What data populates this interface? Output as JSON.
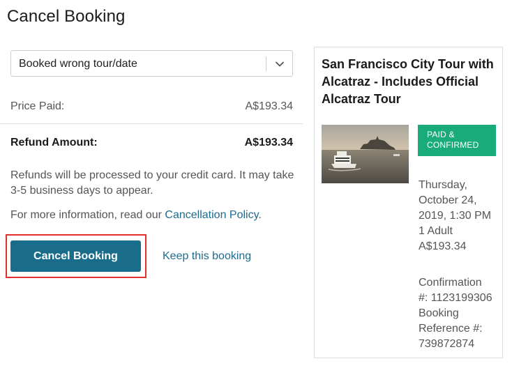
{
  "page": {
    "title": "Cancel Booking"
  },
  "reason_select": {
    "selected": "Booked wrong tour/date"
  },
  "pricing": {
    "price_paid_label": "Price Paid:",
    "price_paid_value": "A$193.34",
    "refund_label": "Refund Amount:",
    "refund_value": "A$193.34"
  },
  "notes": {
    "refund_note": "Refunds will be processed to your credit card. It may take 3-5 business days to appear.",
    "more_info_prefix": "For more information, read our ",
    "policy_link": "Cancellation Policy",
    "more_info_suffix": "."
  },
  "actions": {
    "cancel_label": "Cancel Booking",
    "keep_label": "Keep this booking"
  },
  "booking_card": {
    "title": "San Francisco City Tour with Alcatraz - Includes Official Alcatraz Tour",
    "status_line1": "PAID &",
    "status_line2": "CONFIRMED",
    "date_line1": "Thursday,",
    "date_line2": "October 24,",
    "date_line3": "2019, 1:30 PM",
    "travelers": "1 Adult",
    "price": "A$193.34",
    "confirmation_line1": "Confirmation",
    "confirmation_line2": "#: 1123199306",
    "reference_line1": "Booking",
    "reference_line2": "Reference #:",
    "reference_line3": "739872874"
  },
  "colors": {
    "primary": "#1a6c8b",
    "link": "#1e6b8c",
    "status_green": "#1aab7a",
    "highlight_red": "#e0322b"
  },
  "icons": {
    "dropdown": "chevron-down-icon"
  }
}
